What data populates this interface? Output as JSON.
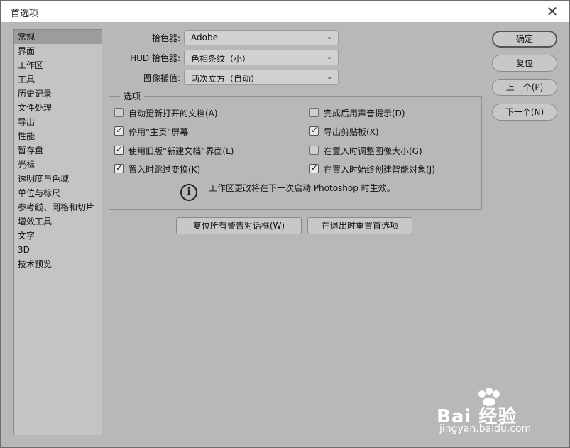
{
  "window": {
    "title": "首选项",
    "close_glyph": "✕"
  },
  "sidebar": {
    "items": [
      {
        "label": "常规",
        "selected": true
      },
      {
        "label": "界面"
      },
      {
        "label": "工作区"
      },
      {
        "label": "工具"
      },
      {
        "label": "历史记录"
      },
      {
        "label": "文件处理"
      },
      {
        "label": "导出"
      },
      {
        "label": "性能"
      },
      {
        "label": "暂存盘"
      },
      {
        "label": "光标"
      },
      {
        "label": "透明度与色域"
      },
      {
        "label": "单位与标尺"
      },
      {
        "label": "参考线、网格和切片"
      },
      {
        "label": "增效工具"
      },
      {
        "label": "文字"
      },
      {
        "label": "3D"
      },
      {
        "label": "技术预览"
      }
    ]
  },
  "fields": {
    "color_picker": {
      "label": "拾色器:",
      "value": "Adobe"
    },
    "hud_color_picker": {
      "label": "HUD 拾色器:",
      "value": "色相条纹（小）"
    },
    "image_interpolation": {
      "label": "图像插值:",
      "value": "两次立方（自动）"
    }
  },
  "options": {
    "legend": "选项",
    "left": [
      {
        "label": "自动更新打开的文档(A)",
        "checked": false
      },
      {
        "label": "停用“主页”屏幕",
        "checked": true
      },
      {
        "label": "使用旧版“新建文档”界面(L)",
        "checked": true
      },
      {
        "label": "置入时跳过变换(K)",
        "checked": true
      }
    ],
    "right": [
      {
        "label": "完成后用声音提示(D)",
        "checked": false
      },
      {
        "label": "导出剪贴板(X)",
        "checked": true
      },
      {
        "label": "在置入时调整图像大小(G)",
        "checked": false
      },
      {
        "label": "在置入时始终创建智能对象(J)",
        "checked": true
      }
    ],
    "info_glyph": "i",
    "info_text": "工作区更改将在下一次启动 Photoshop 时生效。"
  },
  "buttons": {
    "reset_warnings": "复位所有警告对话框(W)",
    "reset_on_quit": "在退出时重置首选项",
    "ok": "确定",
    "reset": "复位",
    "prev": "上一个(P)",
    "next": "下一个(N)"
  },
  "watermark": {
    "logo": "Bai 经验",
    "url": "jingyan.baidu.com"
  },
  "icons": {
    "chevron": "chevron-down-icon",
    "check": "check-icon",
    "info": "info-icon",
    "close": "close-icon"
  }
}
